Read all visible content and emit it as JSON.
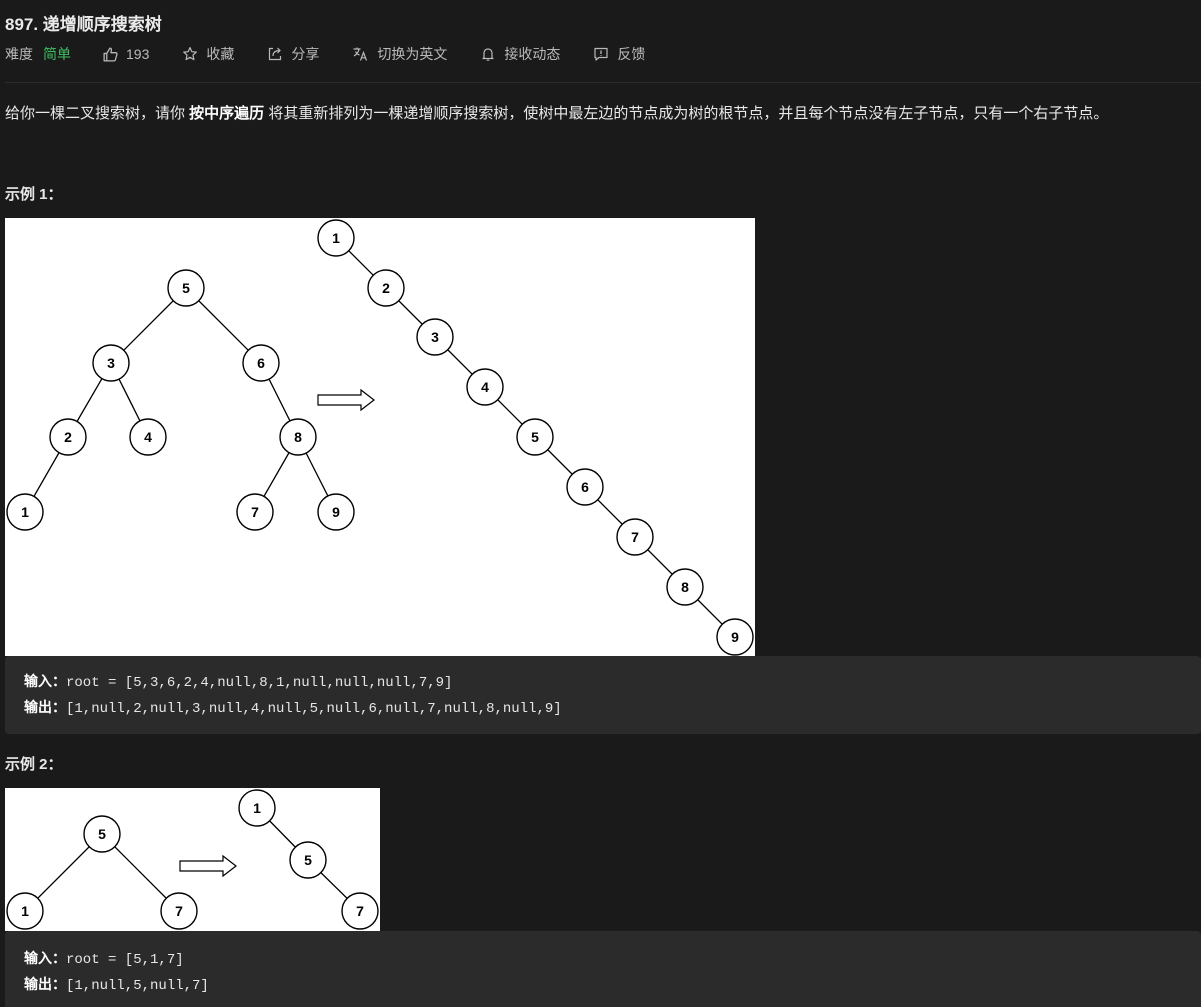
{
  "problem": {
    "title": "897. 递增顺序搜索树",
    "difficulty_label": "难度",
    "difficulty": "简单",
    "likes": "193",
    "favorite_label": "收藏",
    "share_label": "分享",
    "switch_lang_label": "切换为英文",
    "subscribe_label": "接收动态",
    "feedback_label": "反馈"
  },
  "colors": {
    "easy": "#3fbf62",
    "background": "#1a1a1a",
    "code_block": "#2b2b2b"
  },
  "description": {
    "before": "给你一棵二叉搜索树，请你 ",
    "bold": "按中序遍历",
    "after": " 将其重新排列为一棵递增顺序搜索树，使树中最左边的节点成为树的根节点，并且每个节点没有左子节点，只有一个右子节点。"
  },
  "examples": [
    {
      "title": "示例 1：",
      "input_label": "输入：",
      "input": "root = [5,3,6,2,4,null,8,1,null,null,null,7,9]",
      "output_label": "输出：",
      "output": "[1,null,2,null,3,null,4,null,5,null,6,null,7,null,8,null,9]",
      "tree_before": [
        "5",
        "3",
        "6",
        "2",
        "4",
        "8",
        "1",
        "7",
        "9"
      ],
      "tree_after": [
        "1",
        "2",
        "3",
        "4",
        "5",
        "6",
        "7",
        "8",
        "9"
      ]
    },
    {
      "title": "示例 2：",
      "input_label": "输入：",
      "input": "root = [5,1,7]",
      "output_label": "输出：",
      "output": "[1,null,5,null,7]",
      "tree_before": [
        "5",
        "1",
        "7"
      ],
      "tree_after": [
        "1",
        "5",
        "7"
      ]
    }
  ]
}
